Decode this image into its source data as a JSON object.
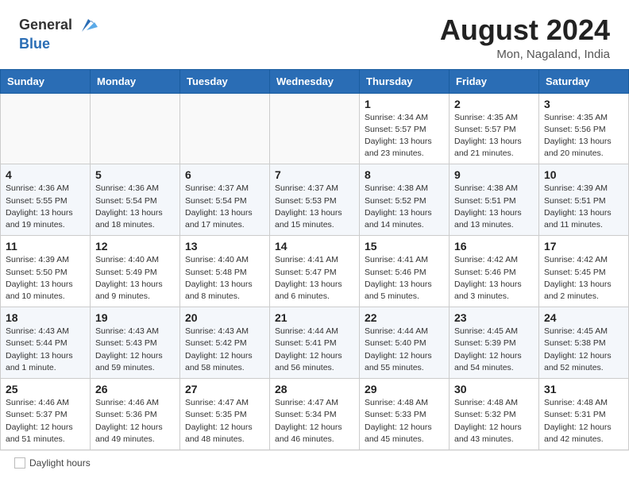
{
  "header": {
    "logo_general": "General",
    "logo_blue": "Blue",
    "month_title": "August 2024",
    "location": "Mon, Nagaland, India"
  },
  "weekdays": [
    "Sunday",
    "Monday",
    "Tuesday",
    "Wednesday",
    "Thursday",
    "Friday",
    "Saturday"
  ],
  "weeks": [
    [
      {
        "day": "",
        "info": ""
      },
      {
        "day": "",
        "info": ""
      },
      {
        "day": "",
        "info": ""
      },
      {
        "day": "",
        "info": ""
      },
      {
        "day": "1",
        "info": "Sunrise: 4:34 AM\nSunset: 5:57 PM\nDaylight: 13 hours\nand 23 minutes."
      },
      {
        "day": "2",
        "info": "Sunrise: 4:35 AM\nSunset: 5:57 PM\nDaylight: 13 hours\nand 21 minutes."
      },
      {
        "day": "3",
        "info": "Sunrise: 4:35 AM\nSunset: 5:56 PM\nDaylight: 13 hours\nand 20 minutes."
      }
    ],
    [
      {
        "day": "4",
        "info": "Sunrise: 4:36 AM\nSunset: 5:55 PM\nDaylight: 13 hours\nand 19 minutes."
      },
      {
        "day": "5",
        "info": "Sunrise: 4:36 AM\nSunset: 5:54 PM\nDaylight: 13 hours\nand 18 minutes."
      },
      {
        "day": "6",
        "info": "Sunrise: 4:37 AM\nSunset: 5:54 PM\nDaylight: 13 hours\nand 17 minutes."
      },
      {
        "day": "7",
        "info": "Sunrise: 4:37 AM\nSunset: 5:53 PM\nDaylight: 13 hours\nand 15 minutes."
      },
      {
        "day": "8",
        "info": "Sunrise: 4:38 AM\nSunset: 5:52 PM\nDaylight: 13 hours\nand 14 minutes."
      },
      {
        "day": "9",
        "info": "Sunrise: 4:38 AM\nSunset: 5:51 PM\nDaylight: 13 hours\nand 13 minutes."
      },
      {
        "day": "10",
        "info": "Sunrise: 4:39 AM\nSunset: 5:51 PM\nDaylight: 13 hours\nand 11 minutes."
      }
    ],
    [
      {
        "day": "11",
        "info": "Sunrise: 4:39 AM\nSunset: 5:50 PM\nDaylight: 13 hours\nand 10 minutes."
      },
      {
        "day": "12",
        "info": "Sunrise: 4:40 AM\nSunset: 5:49 PM\nDaylight: 13 hours\nand 9 minutes."
      },
      {
        "day": "13",
        "info": "Sunrise: 4:40 AM\nSunset: 5:48 PM\nDaylight: 13 hours\nand 8 minutes."
      },
      {
        "day": "14",
        "info": "Sunrise: 4:41 AM\nSunset: 5:47 PM\nDaylight: 13 hours\nand 6 minutes."
      },
      {
        "day": "15",
        "info": "Sunrise: 4:41 AM\nSunset: 5:46 PM\nDaylight: 13 hours\nand 5 minutes."
      },
      {
        "day": "16",
        "info": "Sunrise: 4:42 AM\nSunset: 5:46 PM\nDaylight: 13 hours\nand 3 minutes."
      },
      {
        "day": "17",
        "info": "Sunrise: 4:42 AM\nSunset: 5:45 PM\nDaylight: 13 hours\nand 2 minutes."
      }
    ],
    [
      {
        "day": "18",
        "info": "Sunrise: 4:43 AM\nSunset: 5:44 PM\nDaylight: 13 hours\nand 1 minute."
      },
      {
        "day": "19",
        "info": "Sunrise: 4:43 AM\nSunset: 5:43 PM\nDaylight: 12 hours\nand 59 minutes."
      },
      {
        "day": "20",
        "info": "Sunrise: 4:43 AM\nSunset: 5:42 PM\nDaylight: 12 hours\nand 58 minutes."
      },
      {
        "day": "21",
        "info": "Sunrise: 4:44 AM\nSunset: 5:41 PM\nDaylight: 12 hours\nand 56 minutes."
      },
      {
        "day": "22",
        "info": "Sunrise: 4:44 AM\nSunset: 5:40 PM\nDaylight: 12 hours\nand 55 minutes."
      },
      {
        "day": "23",
        "info": "Sunrise: 4:45 AM\nSunset: 5:39 PM\nDaylight: 12 hours\nand 54 minutes."
      },
      {
        "day": "24",
        "info": "Sunrise: 4:45 AM\nSunset: 5:38 PM\nDaylight: 12 hours\nand 52 minutes."
      }
    ],
    [
      {
        "day": "25",
        "info": "Sunrise: 4:46 AM\nSunset: 5:37 PM\nDaylight: 12 hours\nand 51 minutes."
      },
      {
        "day": "26",
        "info": "Sunrise: 4:46 AM\nSunset: 5:36 PM\nDaylight: 12 hours\nand 49 minutes."
      },
      {
        "day": "27",
        "info": "Sunrise: 4:47 AM\nSunset: 5:35 PM\nDaylight: 12 hours\nand 48 minutes."
      },
      {
        "day": "28",
        "info": "Sunrise: 4:47 AM\nSunset: 5:34 PM\nDaylight: 12 hours\nand 46 minutes."
      },
      {
        "day": "29",
        "info": "Sunrise: 4:48 AM\nSunset: 5:33 PM\nDaylight: 12 hours\nand 45 minutes."
      },
      {
        "day": "30",
        "info": "Sunrise: 4:48 AM\nSunset: 5:32 PM\nDaylight: 12 hours\nand 43 minutes."
      },
      {
        "day": "31",
        "info": "Sunrise: 4:48 AM\nSunset: 5:31 PM\nDaylight: 12 hours\nand 42 minutes."
      }
    ]
  ],
  "footer": {
    "daylight_label": "Daylight hours"
  }
}
